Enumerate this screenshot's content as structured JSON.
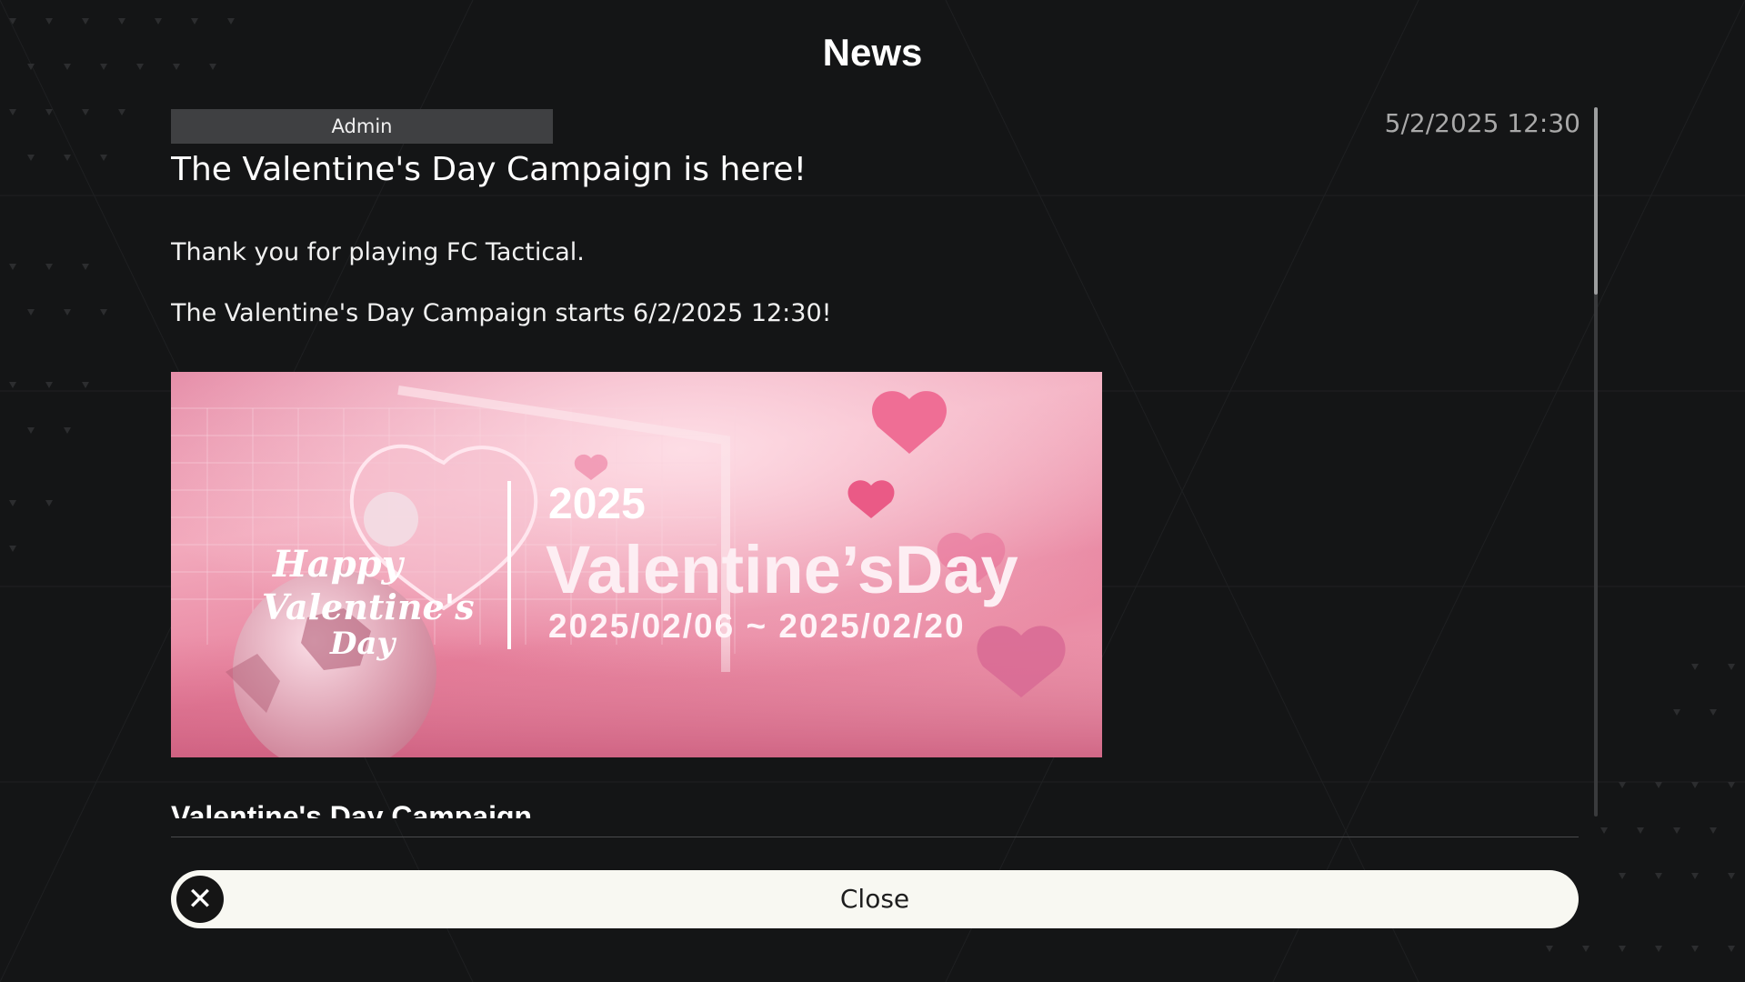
{
  "header": {
    "title": "News"
  },
  "post": {
    "author": "Admin",
    "date": "5/2/2025 12:30",
    "title": "The Valentine's Day Campaign is here!",
    "paragraphs": [
      "Thank you for playing FC Tactical.",
      "The Valentine's Day Campaign starts 6/2/2025 12:30!"
    ],
    "banner": {
      "year": "2025",
      "title": "Valentine’sDay",
      "dates": "2025/02/06 ~ 2025/02/20",
      "script_lines": [
        "Happy",
        "Valentine's",
        "Day"
      ]
    },
    "section_heading": "Valentine's Day Campaign"
  },
  "footer": {
    "close_label": "Close",
    "close_icon": "close-icon"
  },
  "colors": {
    "background": "#141516",
    "button": "#f8f8f2",
    "banner_pink": "#e9879f"
  }
}
